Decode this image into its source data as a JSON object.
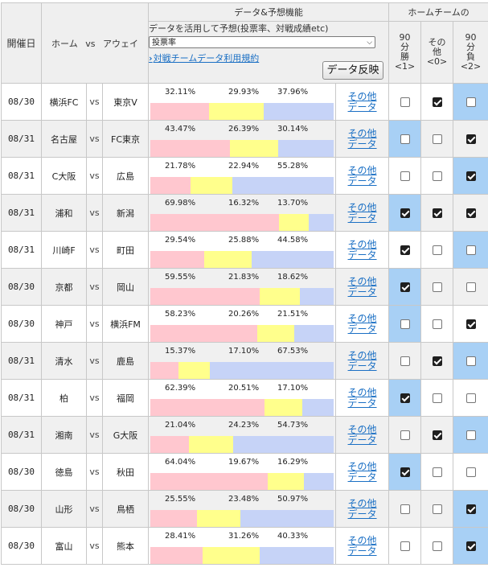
{
  "header": {
    "date_label": "開催日",
    "home": "ホーム",
    "vs": "vs",
    "away": "アウェイ",
    "data_title": "データ&予想機能",
    "home_team_title": "ホームチームの",
    "control_label": "データを活用して予想(投票率、対戦成績etc)",
    "select_value": "投票率",
    "terms_link": "対戦チームデータ利用規約",
    "reflect_button": "データ反映",
    "col_win": [
      "90",
      "分",
      "勝",
      "<1>"
    ],
    "col_other": [
      "その",
      "他",
      "<0>"
    ],
    "col_lose": [
      "90",
      "分",
      "負",
      "<2>"
    ]
  },
  "other_link": [
    "その他",
    "データ"
  ],
  "colors": {
    "home_bar": "#ffc7cf",
    "draw_bar": "#ffff8c",
    "away_bar": "#c6d3f7",
    "highlight": "#a8d0f5"
  },
  "matches": [
    {
      "date": "08/30",
      "home": "横浜FC",
      "vs": "vs",
      "away": "東京V",
      "p1": "32.11%",
      "p2": "29.93%",
      "p3": "37.96%",
      "v1": 32.11,
      "v2": 29.93,
      "v3": 37.96,
      "c1": false,
      "c0": true,
      "c2": false,
      "hl": 2
    },
    {
      "date": "08/31",
      "home": "名古屋",
      "vs": "vs",
      "away": "FC東京",
      "p1": "43.47%",
      "p2": "26.39%",
      "p3": "30.14%",
      "v1": 43.47,
      "v2": 26.39,
      "v3": 30.14,
      "c1": false,
      "c0": false,
      "c2": true,
      "hl": 0
    },
    {
      "date": "08/31",
      "home": "C大阪",
      "vs": "vs",
      "away": "広島",
      "p1": "21.78%",
      "p2": "22.94%",
      "p3": "55.28%",
      "v1": 21.78,
      "v2": 22.94,
      "v3": 55.28,
      "c1": false,
      "c0": false,
      "c2": true,
      "hl": 2
    },
    {
      "date": "08/31",
      "home": "浦和",
      "vs": "vs",
      "away": "新潟",
      "p1": "69.98%",
      "p2": "16.32%",
      "p3": "13.70%",
      "v1": 69.98,
      "v2": 16.32,
      "v3": 13.7,
      "c1": true,
      "c0": true,
      "c2": true,
      "hl": 0
    },
    {
      "date": "08/31",
      "home": "川崎F",
      "vs": "vs",
      "away": "町田",
      "p1": "29.54%",
      "p2": "25.88%",
      "p3": "44.58%",
      "v1": 29.54,
      "v2": 25.88,
      "v3": 44.58,
      "c1": true,
      "c0": false,
      "c2": false,
      "hl": 2
    },
    {
      "date": "08/30",
      "home": "京都",
      "vs": "vs",
      "away": "岡山",
      "p1": "59.55%",
      "p2": "21.83%",
      "p3": "18.62%",
      "v1": 59.55,
      "v2": 21.83,
      "v3": 18.62,
      "c1": true,
      "c0": false,
      "c2": false,
      "hl": 0
    },
    {
      "date": "08/30",
      "home": "神戸",
      "vs": "vs",
      "away": "横浜FM",
      "p1": "58.23%",
      "p2": "20.26%",
      "p3": "21.51%",
      "v1": 58.23,
      "v2": 20.26,
      "v3": 21.51,
      "c1": false,
      "c0": false,
      "c2": true,
      "hl": 0
    },
    {
      "date": "08/31",
      "home": "清水",
      "vs": "vs",
      "away": "鹿島",
      "p1": "15.37%",
      "p2": "17.10%",
      "p3": "67.53%",
      "v1": 15.37,
      "v2": 17.1,
      "v3": 67.53,
      "c1": false,
      "c0": true,
      "c2": false,
      "hl": 2
    },
    {
      "date": "08/31",
      "home": "柏",
      "vs": "vs",
      "away": "福岡",
      "p1": "62.39%",
      "p2": "20.51%",
      "p3": "17.10%",
      "v1": 62.39,
      "v2": 20.51,
      "v3": 17.1,
      "c1": true,
      "c0": false,
      "c2": false,
      "hl": 0
    },
    {
      "date": "08/31",
      "home": "湘南",
      "vs": "vs",
      "away": "G大阪",
      "p1": "21.04%",
      "p2": "24.23%",
      "p3": "54.73%",
      "v1": 21.04,
      "v2": 24.23,
      "v3": 54.73,
      "c1": false,
      "c0": true,
      "c2": false,
      "hl": 2
    },
    {
      "date": "08/30",
      "home": "徳島",
      "vs": "vs",
      "away": "秋田",
      "p1": "64.04%",
      "p2": "19.67%",
      "p3": "16.29%",
      "v1": 64.04,
      "v2": 19.67,
      "v3": 16.29,
      "c1": true,
      "c0": false,
      "c2": false,
      "hl": 0
    },
    {
      "date": "08/30",
      "home": "山形",
      "vs": "vs",
      "away": "鳥栖",
      "p1": "25.55%",
      "p2": "23.48%",
      "p3": "50.97%",
      "v1": 25.55,
      "v2": 23.48,
      "v3": 50.97,
      "c1": false,
      "c0": false,
      "c2": true,
      "hl": 2
    },
    {
      "date": "08/30",
      "home": "富山",
      "vs": "vs",
      "away": "熊本",
      "p1": "28.41%",
      "p2": "31.26%",
      "p3": "40.33%",
      "v1": 28.41,
      "v2": 31.26,
      "v3": 40.33,
      "c1": false,
      "c0": false,
      "c2": true,
      "hl": 2
    }
  ]
}
